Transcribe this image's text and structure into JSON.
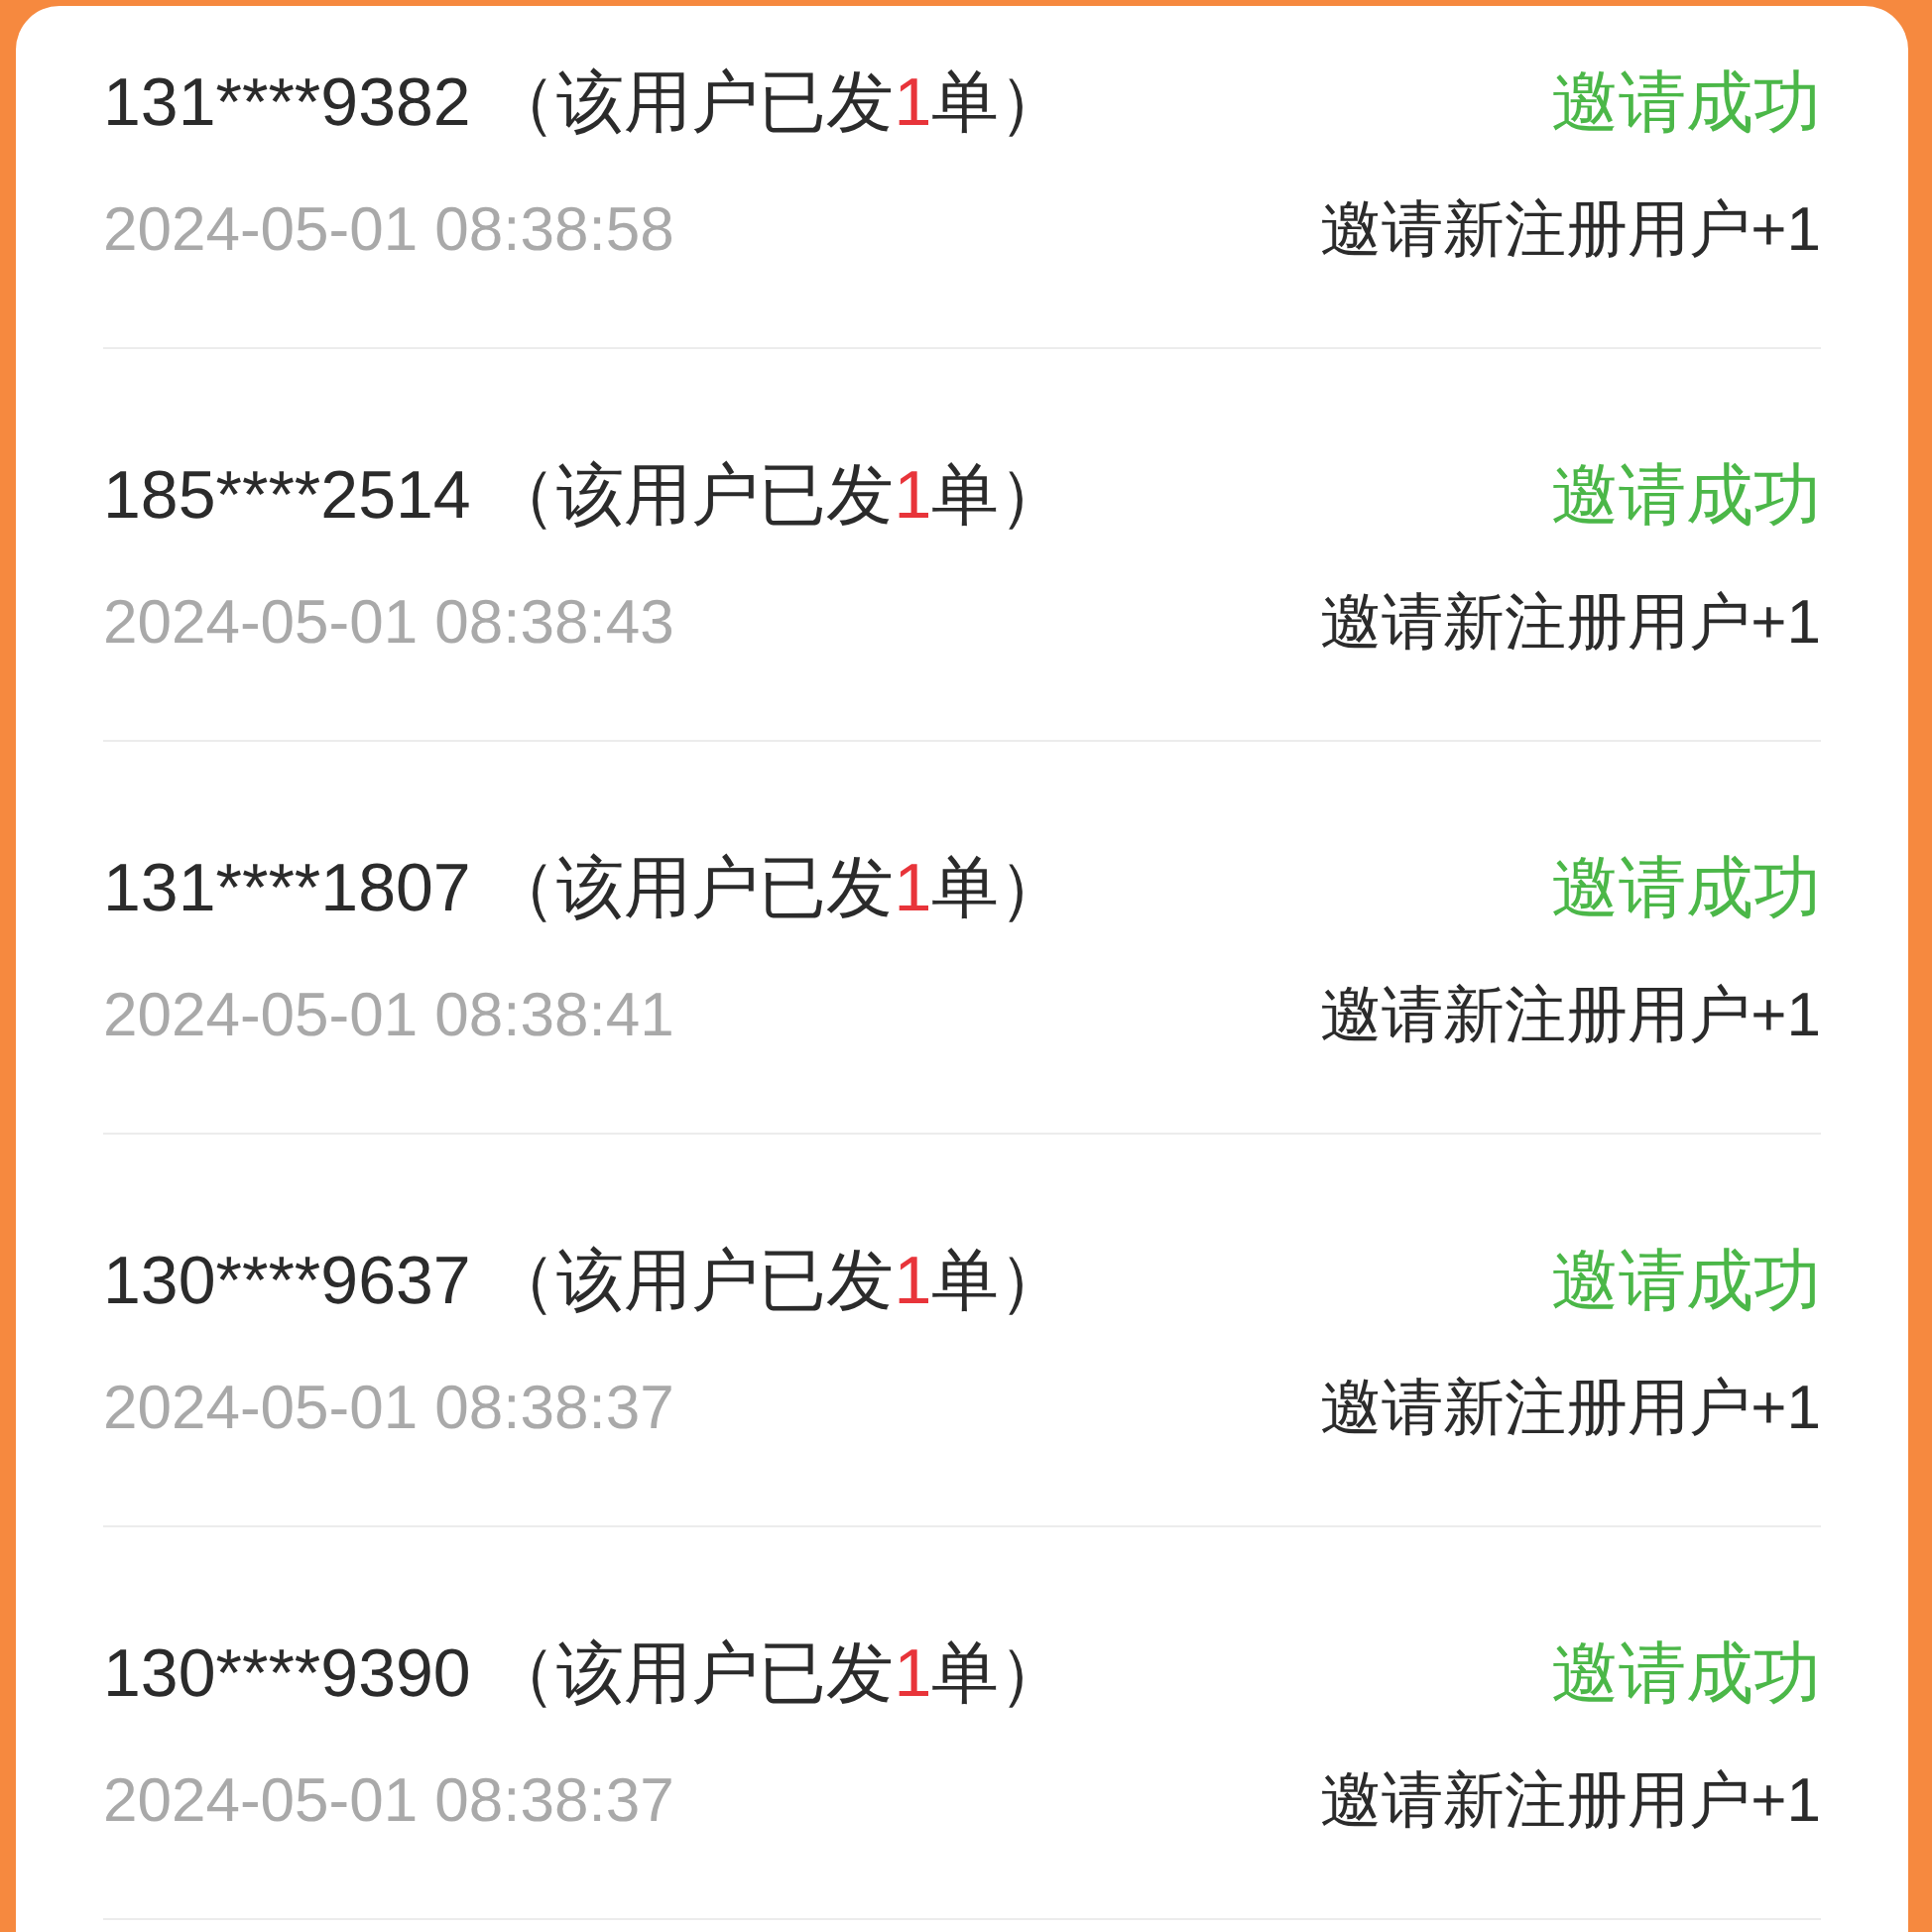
{
  "records": [
    {
      "phone": "131****9382",
      "note_before": "（该用户已发",
      "order_count": "1",
      "note_after": "单）",
      "time": "2024-05-01 08:38:58",
      "status": "邀请成功",
      "reward": "邀请新注册用户+1"
    },
    {
      "phone": "185****2514",
      "note_before": "（该用户已发",
      "order_count": "1",
      "note_after": "单）",
      "time": "2024-05-01 08:38:43",
      "status": "邀请成功",
      "reward": "邀请新注册用户+1"
    },
    {
      "phone": "131****1807",
      "note_before": "（该用户已发",
      "order_count": "1",
      "note_after": "单）",
      "time": "2024-05-01 08:38:41",
      "status": "邀请成功",
      "reward": "邀请新注册用户+1"
    },
    {
      "phone": "130****9637",
      "note_before": "（该用户已发",
      "order_count": "1",
      "note_after": "单）",
      "time": "2024-05-01 08:38:37",
      "status": "邀请成功",
      "reward": "邀请新注册用户+1"
    },
    {
      "phone": "130****9390",
      "note_before": "（该用户已发",
      "order_count": "1",
      "note_after": "单）",
      "time": "2024-05-01 08:38:37",
      "status": "邀请成功",
      "reward": "邀请新注册用户+1"
    }
  ]
}
